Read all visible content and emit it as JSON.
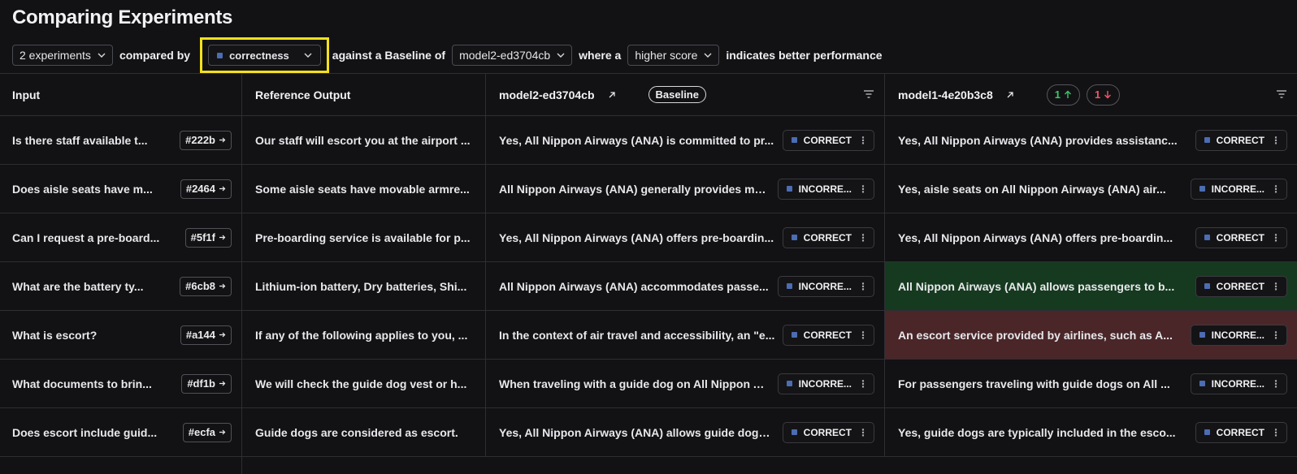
{
  "page": {
    "title": "Comparing Experiments"
  },
  "controls": {
    "experiments_select": "2 experiments",
    "compared_by_label": "compared by",
    "metric_select": "correctness",
    "baseline_label": "against a Baseline of",
    "baseline_select": "model2-ed3704cb",
    "where_label": "where a",
    "direction_select": "higher score",
    "suffix_label": "indicates better performance"
  },
  "columns": {
    "input": "Input",
    "reference": "Reference Output",
    "model_a": "model2-ed3704cb",
    "baseline_badge": "Baseline",
    "model_b": "model1-4e20b3c8",
    "improved_count": "1",
    "regressed_count": "1"
  },
  "colors": {
    "highlight": "#f3e11b",
    "improved_row": "#163a1f",
    "regressed_row": "#4a2628",
    "metric_square": "#4c6cb3"
  },
  "rows": [
    {
      "input": "Is there staff available t...",
      "id": "#222b",
      "reference": "Our staff will escort you at the airport ...",
      "a_text": "Yes, All Nippon Airways (ANA) is committed to pr...",
      "a_score": "CORRECT",
      "b_text": "Yes, All Nippon Airways (ANA) provides assistanc...",
      "b_score": "CORRECT",
      "b_state": ""
    },
    {
      "input": "Does aisle seats have m...",
      "id": "#2464",
      "reference": "Some aisle seats have movable armre...",
      "a_text": "All Nippon Airways (ANA) generally provides mo...",
      "a_score": "INCORRE...",
      "b_text": "Yes, aisle seats on All Nippon Airways (ANA) air...",
      "b_score": "INCORRE...",
      "b_state": ""
    },
    {
      "input": "Can I request a pre-board...",
      "id": "#5f1f",
      "reference": "Pre-boarding service is available for p...",
      "a_text": "Yes, All Nippon Airways (ANA) offers pre-boardin...",
      "a_score": "CORRECT",
      "b_text": "Yes, All Nippon Airways (ANA) offers pre-boardin...",
      "b_score": "CORRECT",
      "b_state": ""
    },
    {
      "input": "What are the battery ty...",
      "id": "#6cb8",
      "reference": "Lithium-ion battery, Dry batteries, Shi...",
      "a_text": "All Nippon Airways (ANA) accommodates passe...",
      "a_score": "INCORRE...",
      "b_text": "All Nippon Airways (ANA) allows passengers to b...",
      "b_score": "CORRECT",
      "b_state": "improved"
    },
    {
      "input": "What is escort?",
      "id": "#a144",
      "reference": "If any of the following applies to you, ...",
      "a_text": "In the context of air travel and accessibility, an \"e...",
      "a_score": "CORRECT",
      "b_text": "An escort service provided by airlines, such as A...",
      "b_score": "INCORRE...",
      "b_state": "regressed"
    },
    {
      "input": "What documents to brin...",
      "id": "#df1b",
      "reference": "We will check the guide dog vest or h...",
      "a_text": "When traveling with a guide dog on All Nippon Ai...",
      "a_score": "INCORRE...",
      "b_text": "For passengers traveling with guide dogs on All ...",
      "b_score": "INCORRE...",
      "b_state": ""
    },
    {
      "input": "Does escort include guid...",
      "id": "#ecfa",
      "reference": "Guide dogs are considered as escort.",
      "a_text": "Yes, All Nippon Airways (ANA) allows guide dogs ...",
      "a_score": "CORRECT",
      "b_text": "Yes, guide dogs are typically included in the esco...",
      "b_score": "CORRECT",
      "b_state": ""
    }
  ]
}
